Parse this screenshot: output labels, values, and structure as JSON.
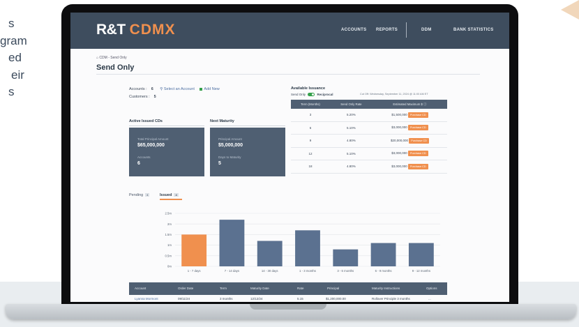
{
  "side_text": [
    "s",
    "gram",
    "ed",
    "eir",
    "s"
  ],
  "header": {
    "logo_main": "R&T",
    "logo_sub": "CDMX",
    "nav": [
      "ACCOUNTS",
      "REPORTS",
      "DDM",
      "BANK STATISTICS"
    ]
  },
  "breadcrumb": "CDM - Send Only",
  "page_title": "Send Only",
  "accounts": {
    "accounts_label": "Accounts",
    "accounts_value": "6",
    "customers_label": "Customers",
    "customers_value": "5",
    "select_link": "Select an Account",
    "add_link": "Add New"
  },
  "active_cds": {
    "title": "Active Issued CDs",
    "principal_label": "Total Principal Amount",
    "principal_value": "$65,000,000",
    "accounts_label": "Accounts",
    "accounts_value": "6"
  },
  "next_maturity": {
    "title": "Next Maturity",
    "principal_label": "Principal Amount",
    "principal_value": "$5,000,000",
    "days_label": "Days to Maturity",
    "days_value": "5"
  },
  "issuance": {
    "title": "Available Issuance",
    "toggle_left": "Send Only",
    "toggle_right": "Reciprocal",
    "cutoff": "Cut Off: Wednesday, September 11, 2024 @ 11:00 AM ET",
    "columns": [
      "Term (Months)",
      "Send Only Rate",
      "Estimated Maximum $"
    ],
    "button_label": "Purchase CD",
    "rows": [
      {
        "term": "3",
        "rate": "5.20%",
        "max": "$1,500,000"
      },
      {
        "term": "6",
        "rate": "5.10%",
        "max": "$3,000,000"
      },
      {
        "term": "9",
        "rate": "4.80%",
        "max": "$20,000,000"
      },
      {
        "term": "12",
        "rate": "5.10%",
        "max": "$3,000,000"
      },
      {
        "term": "18",
        "rate": "4.80%",
        "max": "$3,000,000"
      }
    ]
  },
  "tabs": [
    {
      "label": "Pending",
      "count": "4"
    },
    {
      "label": "Issued",
      "count": "4"
    }
  ],
  "chart_data": {
    "type": "bar",
    "categories": [
      "1 - 7 days",
      "7 - 14 days",
      "14 - 30 days",
      "1 - 3 months",
      "3 - 6 months",
      "6 - 9 months",
      "9 - 12 months"
    ],
    "values": [
      1.5,
      2.2,
      1.2,
      1.7,
      0.8,
      1.1,
      1.1
    ],
    "ytick_labels": [
      "0m",
      "0.5m",
      "1m",
      "1.5m",
      "2m",
      "2.5m"
    ],
    "ylim": [
      0,
      2.5
    ],
    "colors": {
      "highlight": "#f0904e",
      "bar": "#5b7190"
    }
  },
  "table": {
    "columns": [
      "Account",
      "Order Date",
      "Term",
      "Maturity Date",
      "Rate",
      "Principal",
      "Maturity Instructions",
      "Options"
    ],
    "rows": [
      [
        "Lyanna Mormont",
        "09/11/24",
        "3 months",
        "12/12/24",
        "5.15",
        "$1,200,000.00",
        "Rollover Principle 3 months",
        "..."
      ]
    ]
  },
  "colors": {
    "header_bg": "#3e4d5e",
    "accent": "#f0904e",
    "card_bg": "#4f5f72",
    "toggle_on": "#35a04b"
  }
}
